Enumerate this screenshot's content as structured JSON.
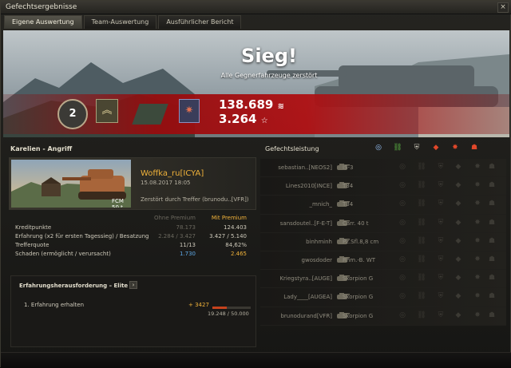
{
  "window": {
    "title": "Gefechtsergebnisse",
    "close_label": "×"
  },
  "tabs": [
    {
      "label": "Eigene Auswertung",
      "active": true
    },
    {
      "label": "Team-Auswertung",
      "active": false
    },
    {
      "label": "Ausführlicher Bericht",
      "active": false
    }
  ],
  "banner": {
    "result": "Sieg!",
    "subtitle": "Alle Gegnerfahrzeuge zerstört",
    "credits": "138.689",
    "xp": "3.264",
    "credits_icon": "credits-icon",
    "xp_icon": "xp-star-icon",
    "rank_badge": "2"
  },
  "battle": {
    "map_mode": "Karelien - Angriff"
  },
  "player": {
    "name": "Woffka_ru[ICYA]",
    "date": "15.08.2017 18:05",
    "fate": "Zerstört durch Treffer (brunodu..[VFR])",
    "tank": "FCM 50 t"
  },
  "stats": {
    "col_without": "Ohne Premium",
    "col_with": "Mit Premium",
    "rows": [
      {
        "label": "Kreditpunkte",
        "v1": "78.173",
        "v2": "124.403"
      },
      {
        "label": "Erfahrung  (x2 für ersten Tagessieg) / Besatzung",
        "v1": "2.284 / 3.427",
        "v2": "3.427 / 5.140"
      },
      {
        "label": "Trefferquote",
        "v1": "11/13",
        "v2": "84,62%"
      },
      {
        "label": "Schaden (ermöglicht / verursacht)",
        "v1": "1.730",
        "v2": "2.465"
      }
    ]
  },
  "challenge": {
    "title": "Erfahrungsherausforderung – Elite",
    "button": "›",
    "task": "1. Erfahrung erhalten",
    "xp_gain": "+ 3427",
    "progress_text": "19.248 / 50.000",
    "progress_fraction": 0.385
  },
  "performance": {
    "title": "Gefechtsleistung",
    "rows": [
      {
        "player": "sebastian..[NEOS2]",
        "tank": "IS-3",
        "on": [
          0,
          1,
          3
        ]
      },
      {
        "player": "Lines2010[INCE]",
        "tank": "T34",
        "on": [
          5
        ]
      },
      {
        "player": "_mnich_",
        "tank": "T34",
        "on": [
          5
        ]
      },
      {
        "player": "sansdoutel..[F-E-T]",
        "tank": "Carr. 40 t",
        "on": [
          5,
          6
        ]
      },
      {
        "player": "binhminh",
        "tank": "Pz.Sfl.8,8 cm",
        "on": [
          0,
          1
        ]
      },
      {
        "player": "gwosdoder",
        "tank": "Rhm.-B. WT",
        "on": [
          5,
          6
        ]
      },
      {
        "player": "Kriegstyra..[AUGE]",
        "tank": "Skorpion G",
        "on": [
          2
        ]
      },
      {
        "player": "Lady____[AUGEA]",
        "tank": "Skorpion G",
        "on": [
          5
        ]
      },
      {
        "player": "brunodurand[VFR]",
        "tank": "Skorpion G",
        "on": [
          4,
          5
        ]
      }
    ]
  },
  "colors": {
    "accent_gold": "#f0b23a",
    "banner_red": "#a80f12",
    "damage_blue": "#5ea9e8"
  }
}
